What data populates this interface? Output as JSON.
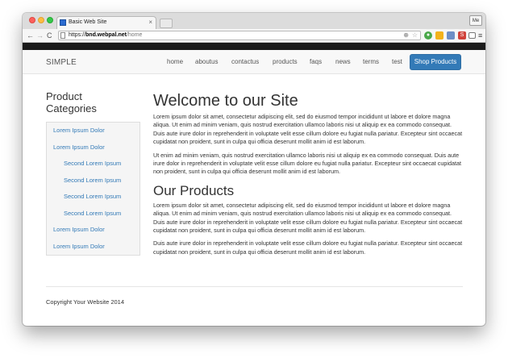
{
  "browser": {
    "tab_title": "Basic Web Site",
    "tab_close": "×",
    "profile": "Me",
    "back": "←",
    "forward": "→",
    "reload": "C",
    "url_protocol": "https://",
    "url_host": "bnd.webpal.net",
    "url_path": "/home",
    "zoom_glyph": "⊕",
    "star_glyph": "☆",
    "menu_glyph": "≡",
    "ext_labels": [
      "●",
      "",
      "",
      "S",
      ""
    ]
  },
  "navbar": {
    "brand": "SIMPLE",
    "links": [
      "home",
      "aboutus",
      "contactus",
      "products",
      "faqs",
      "news",
      "terms",
      "test"
    ],
    "cta": "Shop Products"
  },
  "sidebar": {
    "title": "Product Categories",
    "items": [
      {
        "label": "Lorem Ipsum Dolor",
        "level": 1
      },
      {
        "label": "Lorem Ipsum Dolor",
        "level": 1
      },
      {
        "label": "Second Lorem Ipsum",
        "level": 2
      },
      {
        "label": "Second Lorem Ipsum",
        "level": 2
      },
      {
        "label": "Second Lorem Ipsum",
        "level": 2
      },
      {
        "label": "Second Lorem Ipsum",
        "level": 2
      },
      {
        "label": "Lorem Ipsum Dolor",
        "level": 1
      },
      {
        "label": "Lorem Ipsum Dolor",
        "level": 1
      }
    ]
  },
  "main": {
    "heading": "Welcome to our Site",
    "para1": "Lorem ipsum dolor sit amet, consectetur adipiscing elit, sed do eiusmod tempor incididunt ut labore et dolore magna aliqua. Ut enim ad minim veniam, quis nostrud exercitation ullamco laboris nisi ut aliquip ex ea commodo consequat. Duis aute irure dolor in reprehenderit in voluptate velit esse cillum dolore eu fugiat nulla pariatur. Excepteur sint occaecat cupidatat non proident, sunt in culpa qui officia deserunt mollit anim id est laborum.",
    "para2": "Ut enim ad minim veniam, quis nostrud exercitation ullamco laboris nisi ut aliquip ex ea commodo consequat. Duis aute irure dolor in reprehenderit in voluptate velit esse cillum dolore eu fugiat nulla pariatur. Excepteur sint occaecat cupidatat non proident, sunt in culpa qui officia deserunt mollit anim id est laborum.",
    "subheading": "Our Products",
    "para3": "Lorem ipsum dolor sit amet, consectetur adipiscing elit, sed do eiusmod tempor incididunt ut labore et dolore magna aliqua. Ut enim ad minim veniam, quis nostrud exercitation ullamco laboris nisi ut aliquip ex ea commodo consequat. Duis aute irure dolor in reprehenderit in voluptate velit esse cillum dolore eu fugiat nulla pariatur. Excepteur sint occaecat cupidatat non proident, sunt in culpa qui officia deserunt mollit anim id est laborum.",
    "para4": "Duis aute irure dolor in reprehenderit in voluptate velit esse cillum dolore eu fugiat nulla pariatur. Excepteur sint occaecat cupidatat non proident, sunt in culpa qui officia deserunt mollit anim id est laborum."
  },
  "footer": {
    "copyright": "Copyright Your Website 2014"
  },
  "colors": {
    "link": "#337ab7",
    "cta_bg": "#337ab7",
    "navbar_bg": "#f8f8f8",
    "sidebar_bg": "#f5f5f5",
    "topbar": "#1b1b1b"
  }
}
